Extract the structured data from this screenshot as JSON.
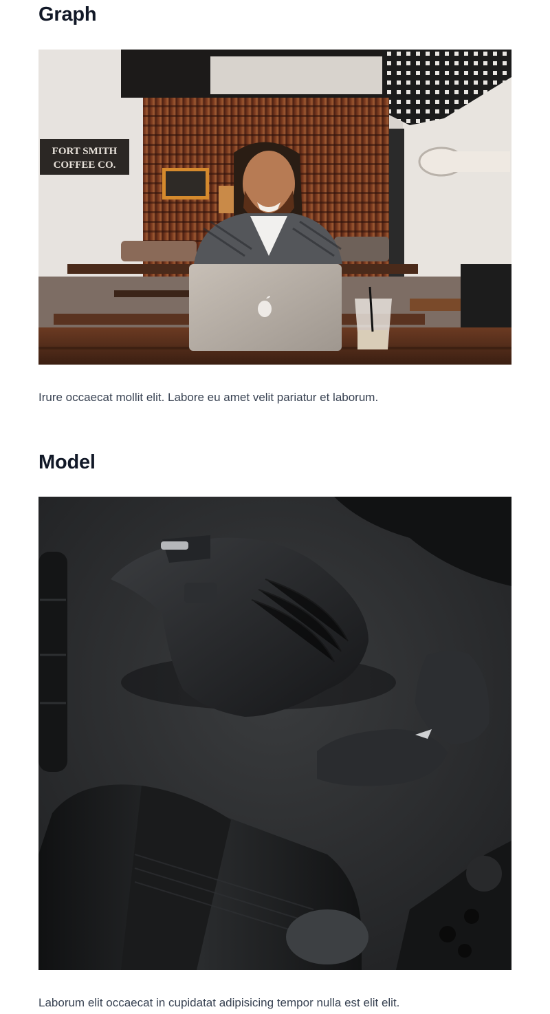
{
  "sections": [
    {
      "title": "Graph",
      "image_alt": "Smiling man with a laptop at a cafe table",
      "caption": "Irure occaecat mollit elit. Labore eu amet velit pariatur et laborum.",
      "image_signs": {
        "left_sign_line1": "FORT SMITH",
        "left_sign_line2": "COFFEE CO."
      }
    },
    {
      "title": "Model",
      "image_alt": "Black computer mouse with camera lenses on a dark surface",
      "caption": "Laborum elit occaecat in cupidatat adipisicing tempor nulla est elit elit."
    }
  ],
  "colors": {
    "heading": "#111827",
    "body_text": "#374151",
    "background": "#ffffff"
  }
}
